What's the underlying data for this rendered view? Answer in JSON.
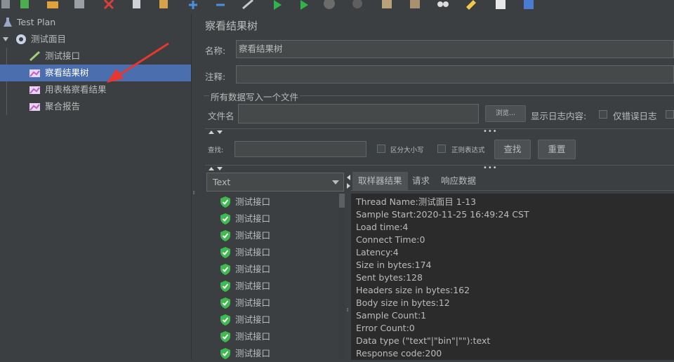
{
  "tree": {
    "root_label": "Test Plan",
    "group_label": "测试面目",
    "children": [
      {
        "label": "测试接口"
      },
      {
        "label": "察看结果树"
      },
      {
        "label": "用表格察看结果"
      },
      {
        "label": "聚合报告"
      }
    ]
  },
  "panel": {
    "title": "察看结果树",
    "name_label": "名称:",
    "name_value": "察看结果树",
    "comment_label": "注释:",
    "comment_value": "",
    "section_title": "所有数据写入一个文件",
    "filename_label": "文件名",
    "filename_value": "",
    "browse_label": "浏览...",
    "log_content_label": "显示日志内容:",
    "errors_only_label": "仅错误日志"
  },
  "search": {
    "label": "查找:",
    "value": "",
    "case_label": "区分大小写",
    "regex_label": "正则表达式",
    "find_button": "查找",
    "reset_button": "重置"
  },
  "renderer": {
    "selected": "Text"
  },
  "results": [
    {
      "label": "测试接口"
    },
    {
      "label": "测试接口"
    },
    {
      "label": "测试接口"
    },
    {
      "label": "测试接口"
    },
    {
      "label": "测试接口"
    },
    {
      "label": "测试接口"
    },
    {
      "label": "测试接口"
    },
    {
      "label": "测试接口"
    },
    {
      "label": "测试接口"
    },
    {
      "label": "测试接口"
    }
  ],
  "detail_tabs": [
    "取样器结果",
    "请求",
    "响应数据"
  ],
  "detail_lines": [
    "Thread Name:测试面目 1-13",
    "Sample Start:2020-11-25 16:49:24 CST",
    "Load time:4",
    "Connect Time:0",
    "Latency:4",
    "Size in bytes:174",
    "Sent bytes:128",
    "Headers size in bytes:162",
    "Body size in bytes:12",
    "Sample Count:1",
    "Error Count:0",
    "Data type (\"text\"|\"bin\"|\"\"):text",
    "Response code:200"
  ],
  "colors": {
    "background": "#3c3f41",
    "selection": "#4b6eaf",
    "success_icon": "#3fb950",
    "annotation_arrow": "#e8372f"
  }
}
